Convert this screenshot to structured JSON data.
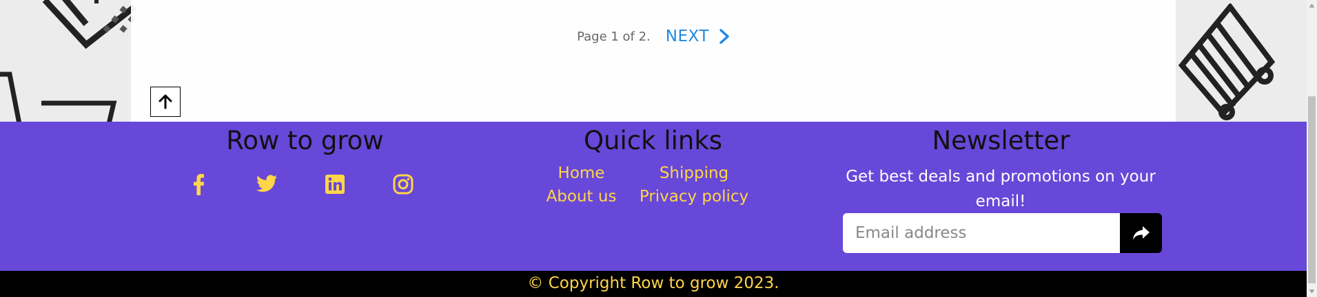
{
  "pagination": {
    "page_info": "Page 1 of 2.",
    "next_label": "NEXT"
  },
  "back_to_top": {
    "icon": "arrow-up-icon"
  },
  "footer": {
    "brand": {
      "title": "Row to grow",
      "social": [
        {
          "name": "facebook-icon"
        },
        {
          "name": "twitter-icon"
        },
        {
          "name": "linkedin-icon"
        },
        {
          "name": "instagram-icon"
        }
      ]
    },
    "quick_links": {
      "title": "Quick links",
      "items": [
        "Home",
        "Shipping",
        "About us",
        "Privacy policy"
      ]
    },
    "newsletter": {
      "title": "Newsletter",
      "text": "Get best deals and promotions on your email!",
      "placeholder": "Email address",
      "submit_icon": "share-arrow-icon"
    },
    "copyright": "© Copyright Row to grow 2023."
  },
  "colors": {
    "footer_bg": "#6748d8",
    "link": "#ffd54a",
    "next_link": "#1e88e5",
    "copyright_bg": "#000000"
  }
}
